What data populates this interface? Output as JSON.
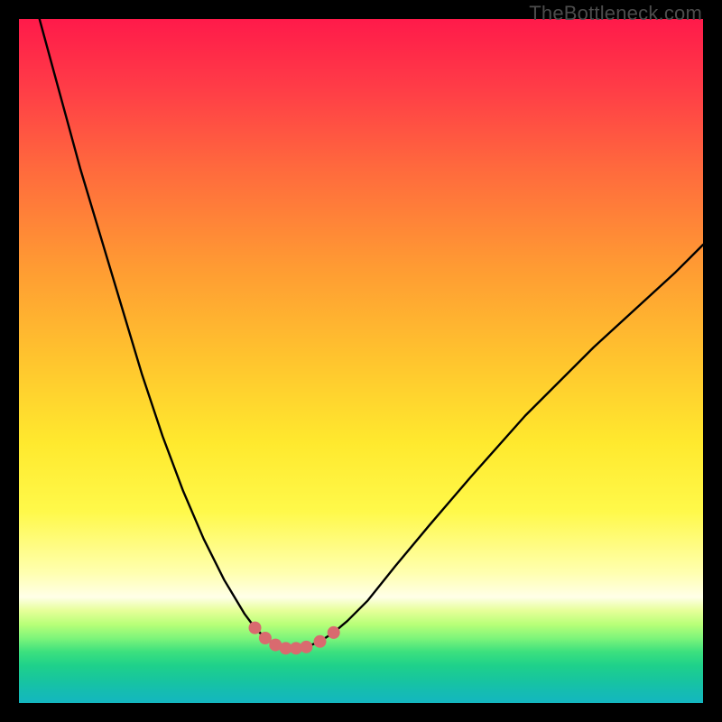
{
  "watermark": {
    "text": "TheBottleneck.com"
  },
  "palette": {
    "frame": "#000000",
    "curve": "#000000",
    "marker_fill": "#d96a6f",
    "marker_stroke": "#d96a6f"
  },
  "chart_data": {
    "type": "line",
    "title": "",
    "xlabel": "",
    "ylabel": "",
    "xlim": [
      0,
      100
    ],
    "ylim": [
      0,
      100
    ],
    "grid": false,
    "legend": false,
    "annotations": [],
    "series": [
      {
        "name": "bottleneck-curve",
        "x": [
          3,
          6,
          9,
          12,
          15,
          18,
          21,
          24,
          27,
          30,
          33,
          34.5,
          36,
          37.5,
          39,
          40.5,
          42,
          44,
          46,
          48,
          51,
          55,
          60,
          66,
          74,
          84,
          96,
          100
        ],
        "values": [
          100,
          89,
          78,
          68,
          58,
          48,
          39,
          31,
          24,
          18,
          13,
          11,
          9.5,
          8.5,
          8,
          8,
          8.2,
          9,
          10.3,
          12,
          15,
          20,
          26,
          33,
          42,
          52,
          63,
          67
        ]
      }
    ],
    "markers": {
      "name": "sweet-spot",
      "x": [
        34.5,
        36,
        37.5,
        39,
        40.5,
        42,
        44,
        46
      ],
      "values": [
        11,
        9.5,
        8.5,
        8,
        8,
        8.2,
        9,
        10.3
      ],
      "style": "circle",
      "radius_px": 7
    }
  }
}
